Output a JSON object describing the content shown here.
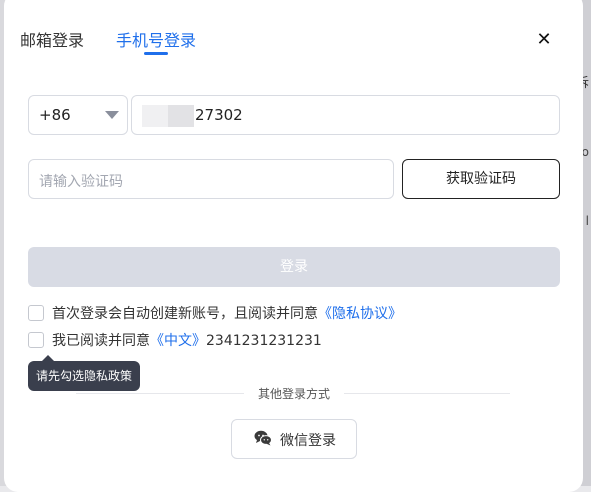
{
  "tabs": {
    "email_label": "邮箱登录",
    "phone_label": "手机号登录",
    "active": "phone",
    "active_color": "#1f6feb"
  },
  "close_icon": {
    "glyph": "✕",
    "icon": "close-icon"
  },
  "backdrop": {
    "marks": [
      "诉",
      "o",
      "l"
    ]
  },
  "phone": {
    "country_code": "+86",
    "value_visible": "27302"
  },
  "verification": {
    "placeholder": "请输入验证码",
    "get_code_label": "获取验证码"
  },
  "login": {
    "label": "登录",
    "disabled_color": "#d8dbe4"
  },
  "agreements": [
    {
      "prefix": "首次登录会自动创建新账号，且阅读并同意",
      "link": "《隐私协议》",
      "suffix": ""
    },
    {
      "prefix": "我已阅读并同意",
      "link": "《中文》",
      "suffix": "2341231231231"
    }
  ],
  "tooltip": "请先勾选隐私政策",
  "other_methods": {
    "divider_text": "其他登录方式",
    "wechat_label": "微信登录",
    "wechat_icon": "wechat-icon"
  }
}
